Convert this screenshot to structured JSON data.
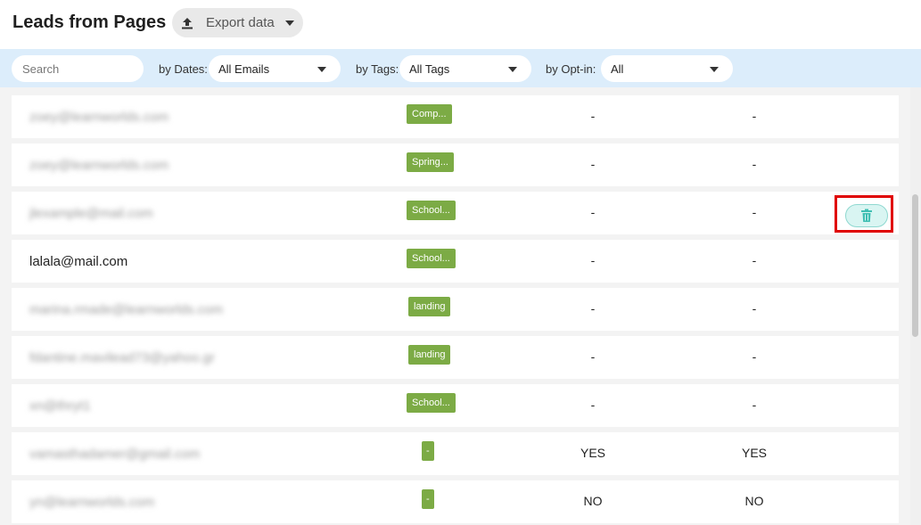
{
  "header": {
    "title": "Leads from Pages",
    "export_label": "Export data"
  },
  "filters": {
    "search_placeholder": "Search",
    "dates_label": "by Dates:",
    "dates_value": "All Emails",
    "tags_label": "by Tags:",
    "tags_value": "All Tags",
    "optin_label": "by Opt-in:",
    "optin_value": "All"
  },
  "rows": [
    {
      "email": "zoey@learnworlds.com",
      "tag": "Comp...",
      "col1": "-",
      "col2": "-"
    },
    {
      "email": "zoey@learnworlds.com",
      "tag": "Spring...",
      "col1": "-",
      "col2": "-"
    },
    {
      "email": "jlexample@mail.com",
      "tag": "School...",
      "col1": "-",
      "col2": "-"
    },
    {
      "email": "lalala@mail.com",
      "tag": "School...",
      "col1": "-",
      "col2": "-"
    },
    {
      "email": "marina.rmade@learnworlds.com",
      "tag": "landing",
      "col1": "-",
      "col2": "-"
    },
    {
      "email": "fdantine.mavilead73@yahoo.gr",
      "tag": "landing",
      "col1": "-",
      "col2": "-"
    },
    {
      "email": "xn@thryt1",
      "tag": "School...",
      "col1": "-",
      "col2": "-"
    },
    {
      "email": "vamasthadamer@gmail.com",
      "tag": "-",
      "col1": "YES",
      "col2": "YES"
    },
    {
      "email": "yn@learnworlds.com",
      "tag": "-",
      "col1": "NO",
      "col2": "NO"
    }
  ],
  "colors": {
    "tag_green": "#7cab45",
    "filterbar_bg": "#dcedfb",
    "highlight_red": "#e00000",
    "trash_teal": "#3fbfb3"
  },
  "icons": {
    "export": "upload-icon",
    "delete": "trash-icon"
  }
}
